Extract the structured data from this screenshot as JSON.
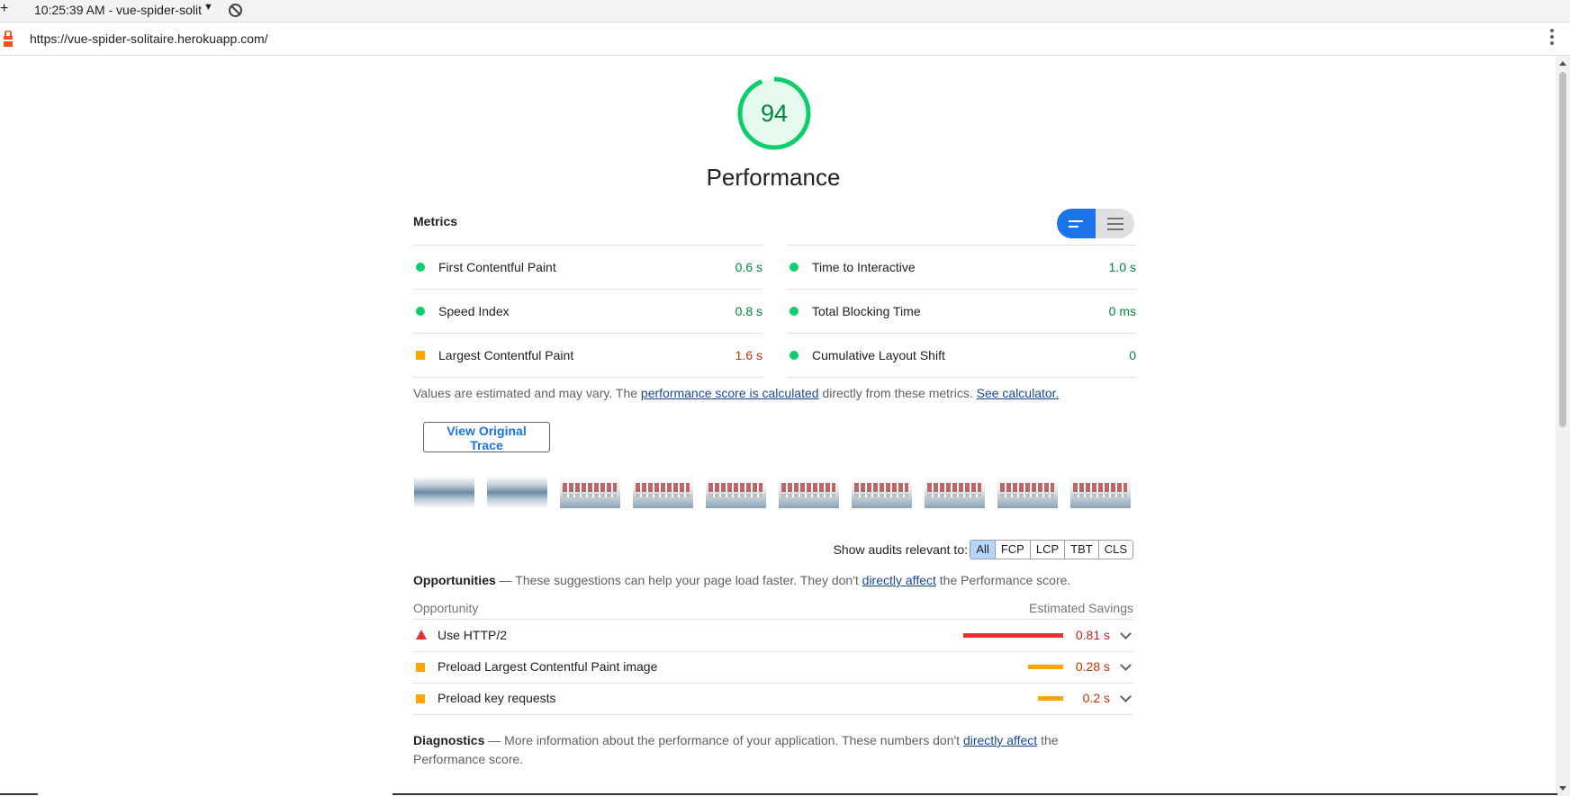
{
  "session": {
    "label": "10:25:39 AM - vue-spider-solit",
    "add_icon": "+",
    "caret": "▼"
  },
  "address": {
    "url": "https://vue-spider-solitaire.herokuapp.com/"
  },
  "score": {
    "value": "94",
    "title": "Performance"
  },
  "metrics": {
    "heading": "Metrics",
    "left": [
      {
        "label": "First Contentful Paint",
        "value": "0.6 s",
        "status": "pass"
      },
      {
        "label": "Speed Index",
        "value": "0.8 s",
        "status": "pass"
      },
      {
        "label": "Largest Contentful Paint",
        "value": "1.6 s",
        "status": "average"
      }
    ],
    "right": [
      {
        "label": "Time to Interactive",
        "value": "1.0 s",
        "status": "pass"
      },
      {
        "label": "Total Blocking Time",
        "value": "0 ms",
        "status": "pass"
      },
      {
        "label": "Cumulative Layout Shift",
        "value": "0",
        "status": "pass"
      }
    ]
  },
  "note": {
    "prefix": "Values are estimated and may vary. The ",
    "link1": "performance score is calculated",
    "middle": " directly from these metrics. ",
    "link2": "See calculator."
  },
  "trace_button": "View Original Trace",
  "filters": {
    "label": "Show audits relevant to:",
    "options": [
      "All",
      "FCP",
      "LCP",
      "TBT",
      "CLS"
    ],
    "active": "All"
  },
  "opportunities": {
    "title": "Opportunities",
    "desc_prefix": " — These suggestions can help your page load faster. They don't ",
    "desc_link": "directly affect",
    "desc_suffix": " the Performance score.",
    "col_left": "Opportunity",
    "col_right": "Estimated Savings",
    "items": [
      {
        "label": "Use HTTP/2",
        "savings": "0.81 s",
        "severity": "fail",
        "bar_fraction": 1.0
      },
      {
        "label": "Preload Largest Contentful Paint image",
        "savings": "0.28 s",
        "severity": "average",
        "bar_fraction": 0.35
      },
      {
        "label": "Preload key requests",
        "savings": "0.2 s",
        "severity": "average",
        "bar_fraction": 0.25
      }
    ]
  },
  "diagnostics": {
    "title": "Diagnostics",
    "desc_prefix": " — More information about the performance of your application. These numbers don't ",
    "desc_link": "directly affect",
    "desc_suffix": " the",
    "desc_line2": "Performance score."
  },
  "colors": {
    "pass": "#0cce6b",
    "average": "#ffa400",
    "fail": "#eb3232",
    "accent": "#1a73e8"
  }
}
